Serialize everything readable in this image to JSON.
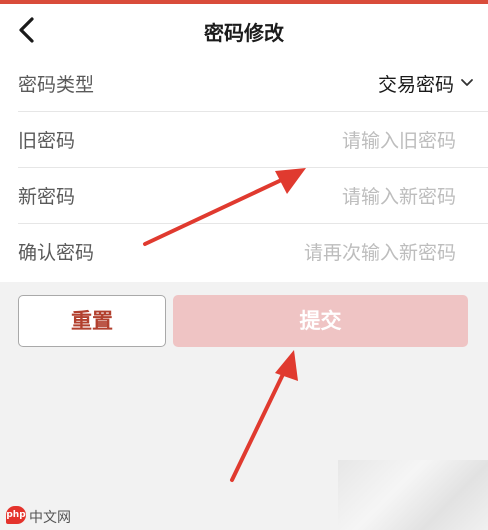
{
  "header": {
    "title": "密码修改",
    "back_icon": "chevron-left-icon"
  },
  "form": {
    "type_label": "密码类型",
    "type_value": "交易密码",
    "old_label": "旧密码",
    "old_placeholder": "请输入旧密码",
    "new_label": "新密码",
    "new_placeholder": "请输入新密码",
    "confirm_label": "确认密码",
    "confirm_placeholder": "请再次输入新密码"
  },
  "actions": {
    "reset_label": "重置",
    "submit_label": "提交"
  },
  "watermark": {
    "logo": "php",
    "text": "中文网"
  },
  "colors": {
    "accent": "#d94c3a",
    "reset_text": "#b2402e",
    "submit_bg": "#efc4c4",
    "arrow": "#e03a2f"
  }
}
